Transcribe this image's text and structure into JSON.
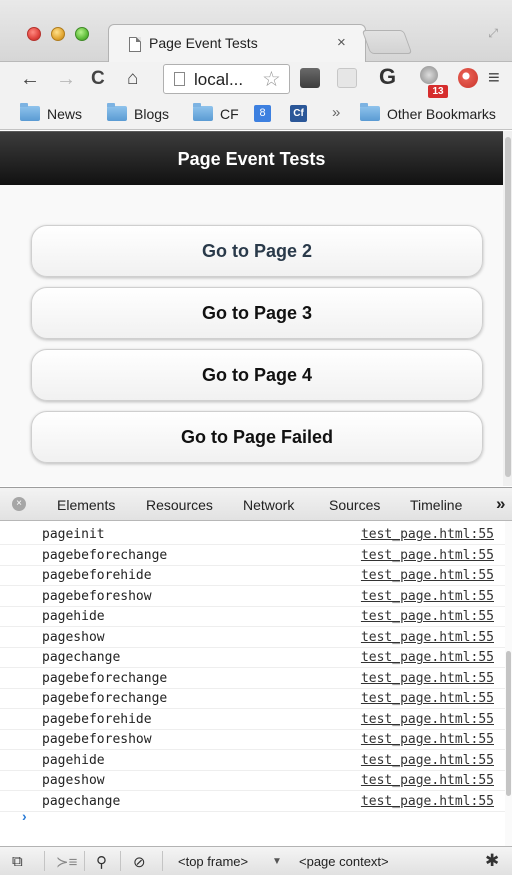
{
  "browser": {
    "tab_title": "Page Event Tests",
    "tab_close": "×",
    "url_display": "local...",
    "bookmarks": [
      "News",
      "Blogs",
      "CF",
      "Other Bookmarks"
    ],
    "bookmarks_overflow": "»",
    "extension_badge": "13",
    "icons": [
      "back-icon",
      "forward-icon",
      "reload-icon",
      "home-icon",
      "star-icon",
      "menu-icon"
    ]
  },
  "page": {
    "header_title": "Page Event Tests",
    "buttons": [
      "Go to Page 2",
      "Go to Page 3",
      "Go to Page 4",
      "Go to Page Failed"
    ]
  },
  "devtools": {
    "tabs": [
      "Elements",
      "Resources",
      "Network",
      "Sources",
      "Timeline"
    ],
    "more": "»",
    "logs": [
      {
        "msg": "pageinit",
        "src": "test_page.html:55"
      },
      {
        "msg": "pagebeforechange",
        "src": "test_page.html:55"
      },
      {
        "msg": "pagebeforehide",
        "src": "test_page.html:55"
      },
      {
        "msg": "pagebeforeshow",
        "src": "test_page.html:55"
      },
      {
        "msg": "pagehide",
        "src": "test_page.html:55"
      },
      {
        "msg": "pageshow",
        "src": "test_page.html:55"
      },
      {
        "msg": "pagechange",
        "src": "test_page.html:55"
      },
      {
        "msg": "pagebeforechange",
        "src": "test_page.html:55"
      },
      {
        "msg": "pagebeforechange",
        "src": "test_page.html:55"
      },
      {
        "msg": "pagebeforehide",
        "src": "test_page.html:55"
      },
      {
        "msg": "pagebeforeshow",
        "src": "test_page.html:55"
      },
      {
        "msg": "pagehide",
        "src": "test_page.html:55"
      },
      {
        "msg": "pageshow",
        "src": "test_page.html:55"
      },
      {
        "msg": "pagechange",
        "src": "test_page.html:55"
      }
    ],
    "prompt": "›",
    "frame_selector": "<top frame>",
    "context_selector": "<page context>"
  }
}
